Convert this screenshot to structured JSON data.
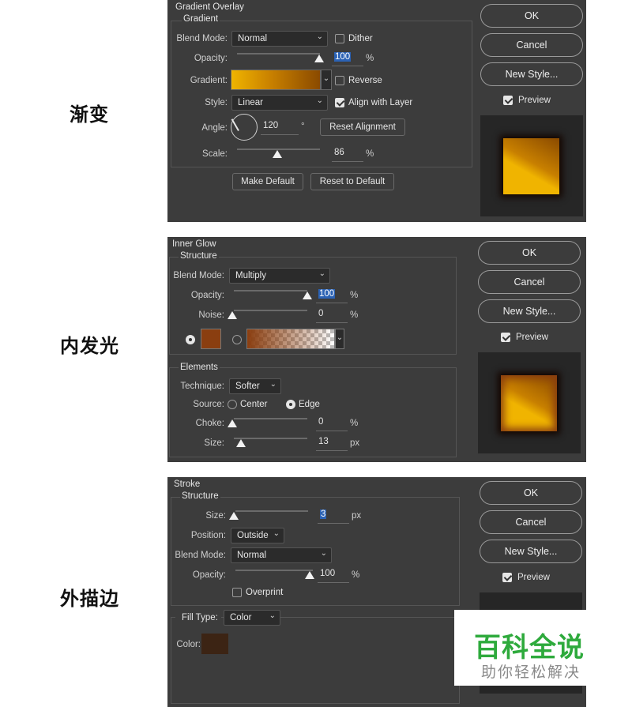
{
  "side_labels": [
    "渐变",
    "内发光",
    "外描边"
  ],
  "buttons": {
    "ok": "OK",
    "cancel": "Cancel",
    "new_style": "New Style...",
    "preview": "Preview"
  },
  "gradient_overlay": {
    "title": "Gradient Overlay",
    "section": "Gradient",
    "blend_mode_label": "Blend Mode:",
    "blend_mode": "Normal",
    "dither": "Dither",
    "opacity_label": "Opacity:",
    "opacity": "100",
    "opacity_level": 1.0,
    "percent": "%",
    "gradient_label": "Gradient:",
    "reverse": "Reverse",
    "style_label": "Style:",
    "style": "Linear",
    "align_with_layer": "Align with Layer",
    "angle_label": "Angle:",
    "angle": "120",
    "degree": "°",
    "reset_alignment": "Reset Alignment",
    "scale_label": "Scale:",
    "scale": "86",
    "scale_level": 0.5,
    "make_default": "Make Default",
    "reset_to_default": "Reset to Default",
    "colors": {
      "gradient_start": "#f0b400",
      "gradient_mid": "#c88000",
      "gradient_end": "#8a4a00"
    }
  },
  "inner_glow": {
    "title": "Inner Glow",
    "section": "Structure",
    "blend_mode_label": "Blend Mode:",
    "blend_mode": "Multiply",
    "opacity_label": "Opacity:",
    "opacity": "100",
    "opacity_level": 1.0,
    "noise_label": "Noise:",
    "noise": "0",
    "noise_level": 0.0,
    "percent": "%",
    "elements": "Elements",
    "technique_label": "Technique:",
    "technique": "Softer",
    "source_label": "Source:",
    "center": "Center",
    "edge": "Edge",
    "choke_label": "Choke:",
    "choke": "0",
    "choke_level": 0.0,
    "size_label": "Size:",
    "size": "13",
    "size_level": 0.1,
    "px": "px",
    "colors": {
      "glow": "#8a3e10"
    }
  },
  "stroke": {
    "title": "Stroke",
    "section": "Structure",
    "size_label": "Size:",
    "size": "3",
    "size_level": 0.0,
    "px": "px",
    "position_label": "Position:",
    "position": "Outside",
    "blend_mode_label": "Blend Mode:",
    "blend_mode": "Normal",
    "opacity_label": "Opacity:",
    "opacity": "100",
    "opacity_level": 1.0,
    "percent": "%",
    "overprint": "Overprint",
    "fill_type_label": "Fill Type:",
    "fill_type": "Color",
    "color_label": "Color:",
    "colors": {
      "stroke": "#3c2414"
    }
  },
  "watermark": {
    "brand": "百科全说",
    "tagline": "助你轻松解决",
    "brand_color": "#2eaa3c"
  }
}
